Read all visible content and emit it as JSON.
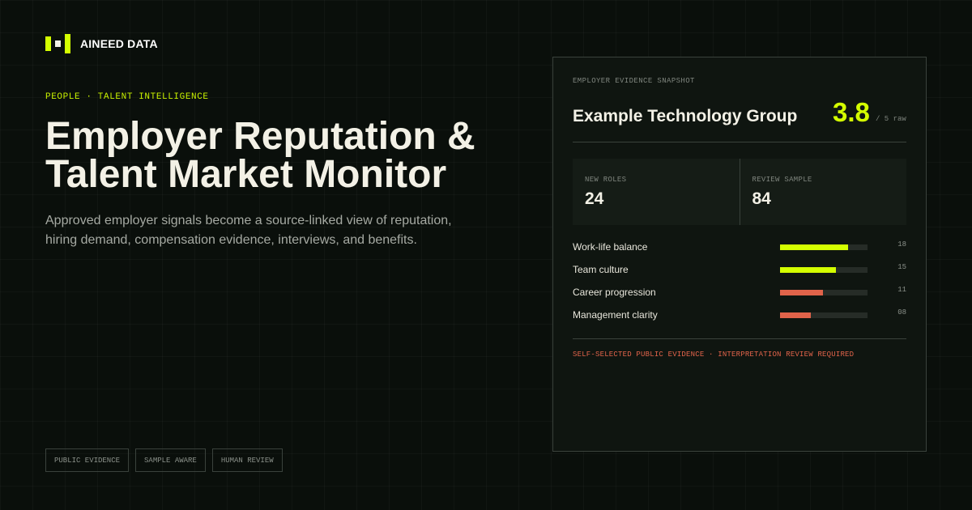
{
  "brand": {
    "name": "AINEED DATA",
    "logo_icon": "logo-mark-icon"
  },
  "hero": {
    "eyebrow": "PEOPLE · TALENT INTELLIGENCE",
    "title_line1": "Employer Reputation &",
    "title_line2": "Talent Market Monitor",
    "subtitle": "Approved employer signals become a source-linked view of reputation, hiring demand, compensation evidence, interviews, and benefits."
  },
  "tags": [
    "PUBLIC EVIDENCE",
    "SAMPLE AWARE",
    "HUMAN REVIEW"
  ],
  "card": {
    "eyebrow": "EMPLOYER EVIDENCE SNAPSHOT",
    "company": "Example Technology Group",
    "score": "3.8",
    "score_unit": "/ 5 raw",
    "stats": [
      {
        "label": "NEW ROLES",
        "value": "24"
      },
      {
        "label": "REVIEW SAMPLE",
        "value": "84"
      }
    ],
    "metrics": [
      {
        "label": "Work-life balance",
        "value": "18",
        "fill": 0.78,
        "color": "#d4ff00"
      },
      {
        "label": "Team culture",
        "value": "15",
        "fill": 0.64,
        "color": "#d4ff00"
      },
      {
        "label": "Career progression",
        "value": "11",
        "fill": 0.49,
        "color": "#e0634a"
      },
      {
        "label": "Management clarity",
        "value": "08",
        "fill": 0.35,
        "color": "#e0634a"
      }
    ],
    "disclaimer": "SELF-SELECTED PUBLIC EVIDENCE · INTERPRETATION REVIEW REQUIRED"
  },
  "colors": {
    "accent": "#d4ff00",
    "warning": "#e0634a",
    "background": "#0a0f0b"
  }
}
